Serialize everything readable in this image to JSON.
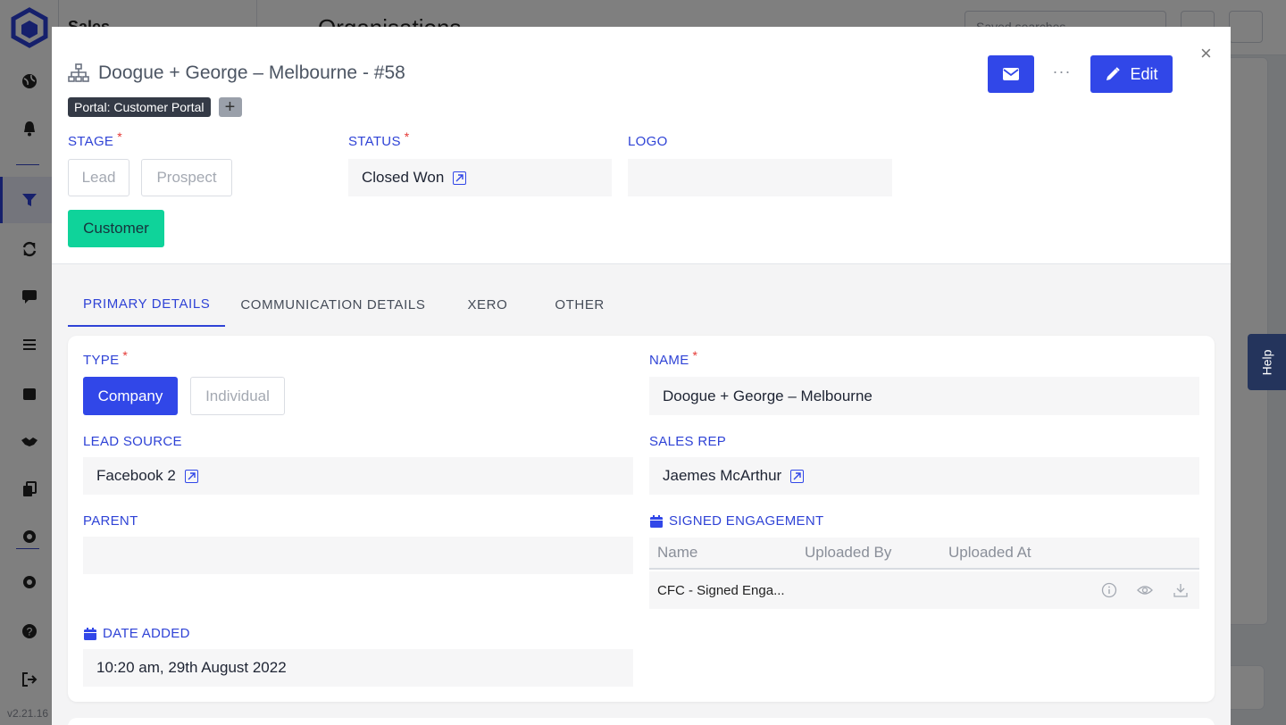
{
  "app": {
    "version": "v2.21.16",
    "subnav_title": "Sales",
    "page_title": "Organisations",
    "saved_searches_placeholder": "Saved searches",
    "help_label": "Help"
  },
  "modal": {
    "title": "Doogue + George – Melbourne - #58",
    "tags": [
      "Portal: Customer Portal"
    ],
    "add_tag_label": "+",
    "more_label": "···",
    "edit_label": "Edit",
    "close_label": "×",
    "stage": {
      "label": "STAGE",
      "options": [
        "Lead",
        "Prospect",
        "Customer"
      ],
      "selected": "Customer"
    },
    "status": {
      "label": "STATUS",
      "value": "Closed Won"
    },
    "logo": {
      "label": "LOGO",
      "value": ""
    }
  },
  "tabs": [
    "PRIMARY DETAILS",
    "COMMUNICATION DETAILS",
    "XERO",
    "OTHER"
  ],
  "active_tab": "PRIMARY DETAILS",
  "primary": {
    "type": {
      "label": "TYPE",
      "options": [
        "Company",
        "Individual"
      ],
      "selected": "Company"
    },
    "name": {
      "label": "NAME",
      "value": "Doogue + George – Melbourne"
    },
    "lead_source": {
      "label": "LEAD SOURCE",
      "value": "Facebook 2"
    },
    "sales_rep": {
      "label": "SALES REP",
      "value": "Jaemes McArthur"
    },
    "parent": {
      "label": "PARENT",
      "value": ""
    },
    "signed_engagement": {
      "label": "SIGNED ENGAGEMENT",
      "columns": [
        "Name",
        "Uploaded By",
        "Uploaded At"
      ],
      "rows": [
        {
          "name": "CFC - Signed Enga...",
          "uploaded_by": "",
          "uploaded_at": ""
        }
      ]
    },
    "date_added": {
      "label": "DATE ADDED",
      "value": "10:20 am, 29th August 2022"
    }
  },
  "colors": {
    "primary": "#3147e8",
    "success": "#0fd39a",
    "label": "#2f43d6",
    "required": "#e53935"
  }
}
